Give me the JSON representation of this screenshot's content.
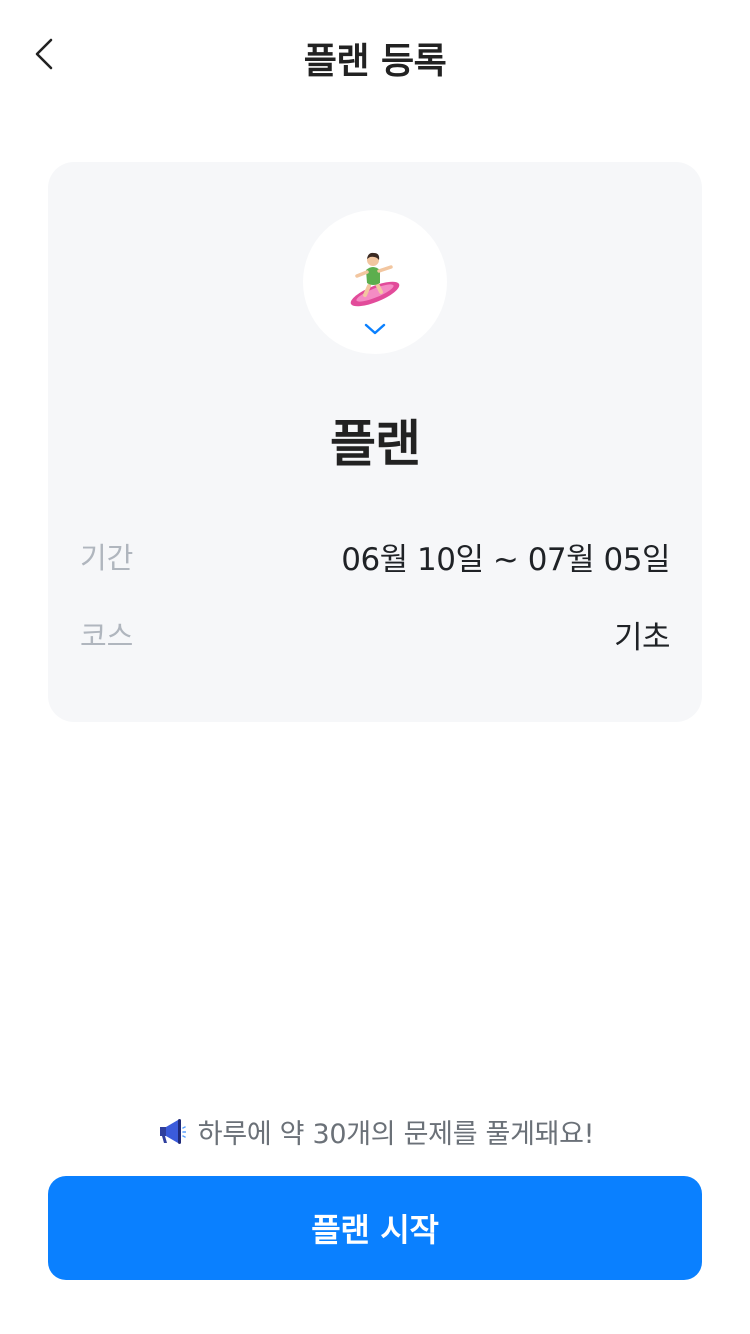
{
  "header": {
    "title": "플랜 등록",
    "back_icon": "chevron-left-icon"
  },
  "plan": {
    "avatar_icon": "surfer-emoji-icon",
    "selector_icon": "chevron-down-icon",
    "name": "플랜",
    "rows": [
      {
        "label": "기간",
        "value": "06월 10일 ~ 07월 05일"
      },
      {
        "label": "코스",
        "value": "기초"
      }
    ]
  },
  "notice": {
    "icon": "megaphone-icon",
    "text": "하루에 약 30개의 문제를 풀게돼요!"
  },
  "cta": {
    "label": "플랜 시작"
  },
  "colors": {
    "accent": "#0a80ff",
    "card_bg": "#f6f7f9",
    "label_gray": "#b0b6be",
    "notice_gray": "#6b7178"
  }
}
